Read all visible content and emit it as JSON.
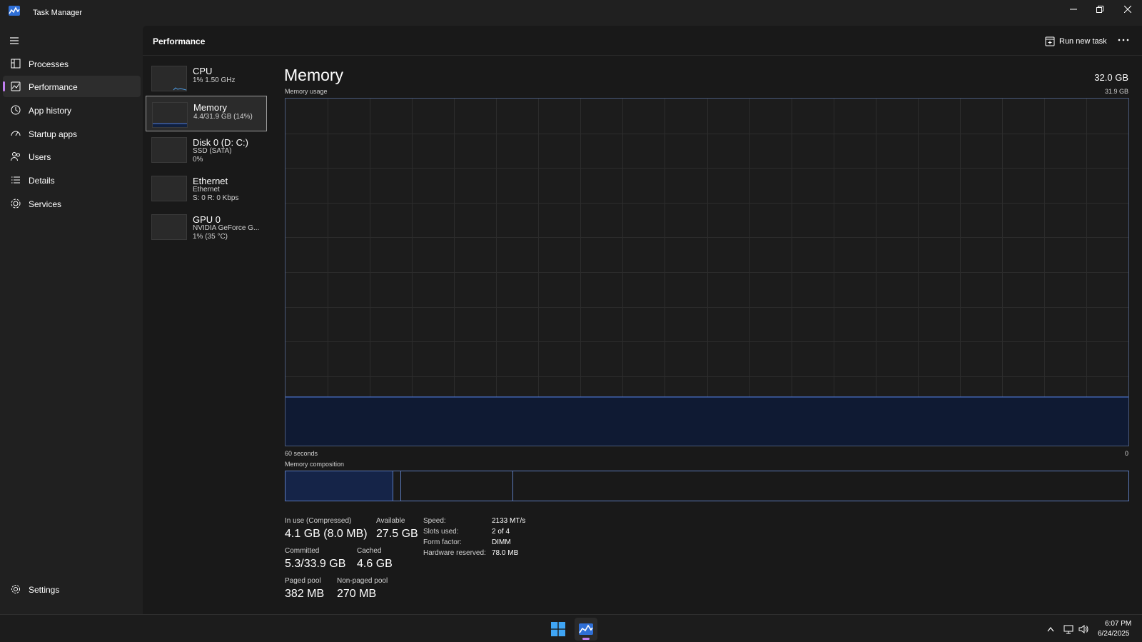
{
  "window": {
    "title": "Task Manager"
  },
  "nav": {
    "items": [
      {
        "label": "Processes",
        "icon": "processes-icon"
      },
      {
        "label": "Performance",
        "icon": "performance-icon",
        "active": true
      },
      {
        "label": "App history",
        "icon": "history-icon"
      },
      {
        "label": "Startup apps",
        "icon": "startup-icon"
      },
      {
        "label": "Users",
        "icon": "users-icon"
      },
      {
        "label": "Details",
        "icon": "details-icon"
      },
      {
        "label": "Services",
        "icon": "services-icon"
      }
    ],
    "settings_label": "Settings"
  },
  "header": {
    "title": "Performance",
    "run_new_task": "Run new task"
  },
  "devices": [
    {
      "name": "CPU",
      "lines": [
        "1% 1.50 GHz"
      ]
    },
    {
      "name": "Memory",
      "lines": [
        "4.4/31.9 GB (14%)"
      ],
      "active": true
    },
    {
      "name": "Disk 0 (D: C:)",
      "lines": [
        "SSD (SATA)",
        "0%"
      ]
    },
    {
      "name": "Ethernet",
      "lines": [
        "Ethernet",
        "S: 0 R: 0 Kbps"
      ]
    },
    {
      "name": "GPU 0",
      "lines": [
        "NVIDIA GeForce G...",
        "1% (35 °C)"
      ]
    }
  ],
  "memory": {
    "title": "Memory",
    "total": "32.0 GB",
    "usage_label": "Memory usage",
    "usage_max": "31.9 GB",
    "axis_left": "60 seconds",
    "axis_right": "0",
    "usage_fraction": 0.14,
    "composition_label": "Memory composition",
    "stats": {
      "in_use_label": "In use (Compressed)",
      "in_use_value": "4.1 GB (8.0 MB)",
      "available_label": "Available",
      "available_value": "27.5 GB",
      "committed_label": "Committed",
      "committed_value": "5.3/33.9 GB",
      "cached_label": "Cached",
      "cached_value": "4.6 GB",
      "paged_label": "Paged pool",
      "paged_value": "382 MB",
      "nonpaged_label": "Non-paged pool",
      "nonpaged_value": "270 MB"
    },
    "specs": [
      {
        "label": "Speed:",
        "value": "2133 MT/s"
      },
      {
        "label": "Slots used:",
        "value": "2 of 4"
      },
      {
        "label": "Form factor:",
        "value": "DIMM"
      },
      {
        "label": "Hardware reserved:",
        "value": "78.0 MB"
      }
    ]
  },
  "taskbar": {
    "time": "6:07 PM",
    "date": "6/24/2025"
  },
  "colors": {
    "accent": "#c07ef0",
    "graph_line": "#4f7ad8",
    "graph_fill": "#0f1a33"
  }
}
